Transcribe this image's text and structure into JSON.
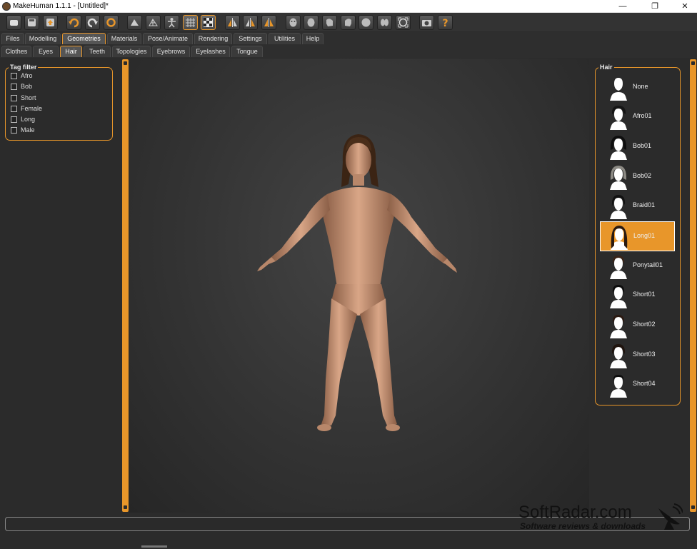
{
  "window": {
    "title": "MakeHuman 1.1.1 - [Untitled]*",
    "minimize": "—",
    "restore": "❐",
    "close": "✕"
  },
  "toolbar": {
    "icons": [
      "new-icon",
      "save-icon",
      "export-icon",
      "undo-icon",
      "redo-icon",
      "reset-icon",
      "smooth-icon",
      "wireframe-icon",
      "pose-icon",
      "grid-icon",
      "checker-icon",
      "symmetry-right-icon",
      "symmetry-left-icon",
      "symmetry-icon",
      "front-view-icon",
      "back-view-icon",
      "left-view-icon",
      "right-view-icon",
      "top-view-icon",
      "bottom-view-icon",
      "reset-camera-icon",
      "screenshot-icon",
      "help-icon"
    ],
    "selected": [
      "grid-icon",
      "checker-icon"
    ]
  },
  "main_tabs": [
    "Files",
    "Modelling",
    "Geometries",
    "Materials",
    "Pose/Animate",
    "Rendering",
    "Settings",
    "Utilities",
    "Help"
  ],
  "main_tab_active": "Geometries",
  "sub_tabs": [
    "Clothes",
    "Eyes",
    "Hair",
    "Teeth",
    "Topologies",
    "Eyebrows",
    "Eyelashes",
    "Tongue"
  ],
  "sub_tab_active": "Hair",
  "tag_filter": {
    "title": "Tag filter",
    "items": [
      "Afro",
      "Bob",
      "Short",
      "Female",
      "Long",
      "Male"
    ]
  },
  "hair_panel": {
    "title": "Hair",
    "items": [
      "None",
      "Afro01",
      "Bob01",
      "Bob02",
      "Braid01",
      "Long01",
      "Ponytail01",
      "Short01",
      "Short02",
      "Short03",
      "Short04"
    ],
    "selected": "Long01"
  },
  "watermark": {
    "line1": "SoftRadar.com",
    "line2": "Software reviews & downloads"
  },
  "colors": {
    "accent": "#e8962a",
    "background": "#2b2b2b"
  }
}
